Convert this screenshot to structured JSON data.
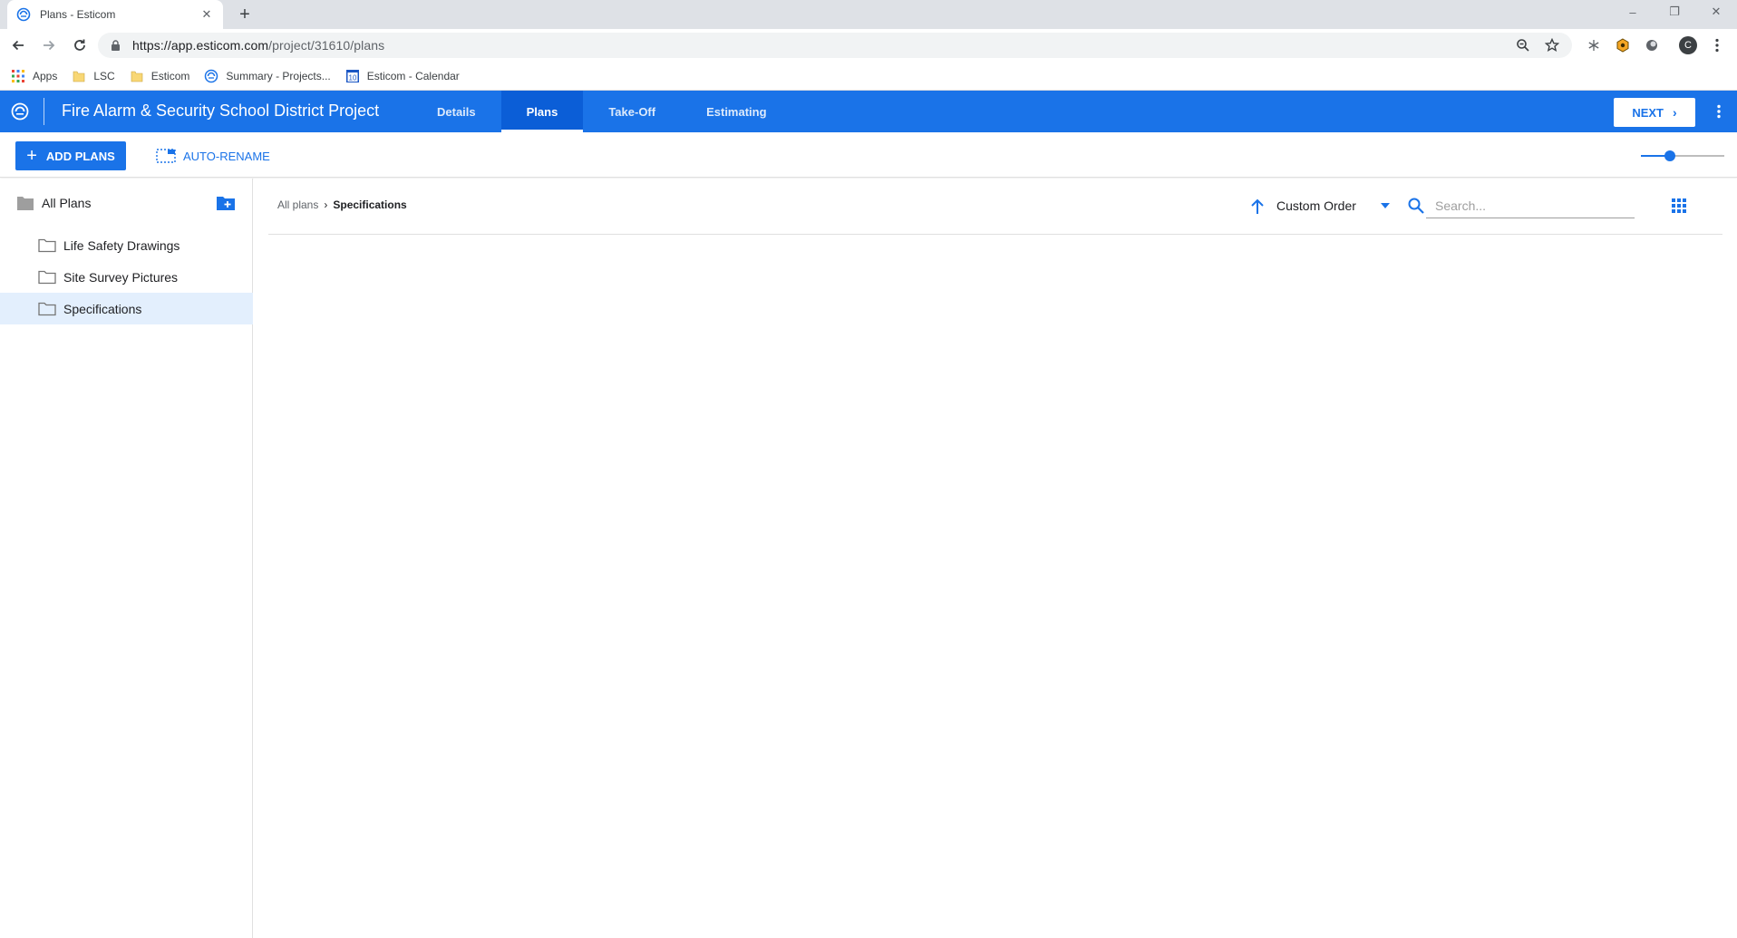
{
  "browser": {
    "tab_title": "Plans - Esticom",
    "tab_close": "✕",
    "new_tab": "+",
    "url_host": "https://app.esticom.com",
    "url_path": "/project/31610/plans",
    "profile_initial": "C",
    "window_controls": {
      "minimize": "–",
      "restore": "❐",
      "close": "✕"
    }
  },
  "bookmarks": [
    {
      "label": "Apps",
      "icon": "apps-grid-icon"
    },
    {
      "label": "LSC",
      "icon": "folder-icon"
    },
    {
      "label": "Esticom",
      "icon": "folder-icon"
    },
    {
      "label": "Summary - Projects...",
      "icon": "esticom-icon"
    },
    {
      "label": "Esticom - Calendar",
      "icon": "calendar-icon",
      "calendar_day": "10"
    }
  ],
  "header": {
    "project_title": "Fire Alarm & Security School District Project",
    "tabs": [
      {
        "label": "Details",
        "active": false
      },
      {
        "label": "Plans",
        "active": true
      },
      {
        "label": "Take-Off",
        "active": false
      },
      {
        "label": "Estimating",
        "active": false
      }
    ],
    "next_label": "NEXT",
    "next_chevron": "›"
  },
  "actions": {
    "add_plans_label": "ADD PLANS",
    "auto_rename_label": "AUTO-RENAME",
    "zoom_level": 0.35
  },
  "sidebar": {
    "root_label": "All Plans",
    "folders": [
      {
        "label": "Life Safety Drawings",
        "selected": false
      },
      {
        "label": "Site Survey Pictures",
        "selected": false
      },
      {
        "label": "Specifications",
        "selected": true
      }
    ]
  },
  "main": {
    "breadcrumb_root": "All plans",
    "breadcrumb_sep": "›",
    "breadcrumb_current": "Specifications",
    "sort_label": "Custom Order",
    "search_placeholder": "Search..."
  },
  "colors": {
    "brand_blue": "#1a73e8",
    "active_tab": "#0b5ed7",
    "selected_folder": "#e3effd"
  }
}
